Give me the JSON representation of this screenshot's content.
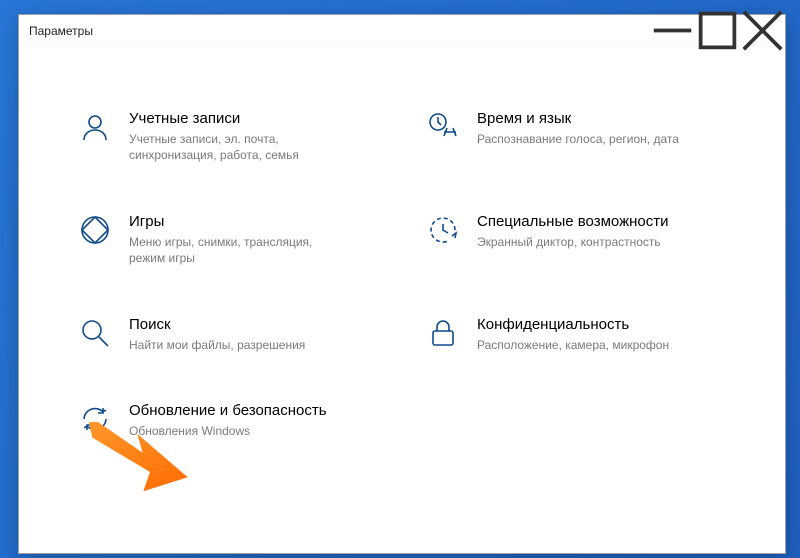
{
  "window": {
    "title": "Параметры"
  },
  "tiles": [
    {
      "title": "Учетные записи",
      "desc": "Учетные записи, эл. почта, синхронизация, работа, семья"
    },
    {
      "title": "Время и язык",
      "desc": "Распознавание голоса, регион, дата"
    },
    {
      "title": "Игры",
      "desc": "Меню игры, снимки, трансляция, режим игры"
    },
    {
      "title": "Специальные возможности",
      "desc": "Экранный диктор, контрастность"
    },
    {
      "title": "Поиск",
      "desc": "Найти мои файлы, разрешения"
    },
    {
      "title": "Конфиденциальность",
      "desc": "Расположение, камера, микрофон"
    },
    {
      "title": "Обновление и безопасность",
      "desc": "Обновления Windows"
    }
  ]
}
